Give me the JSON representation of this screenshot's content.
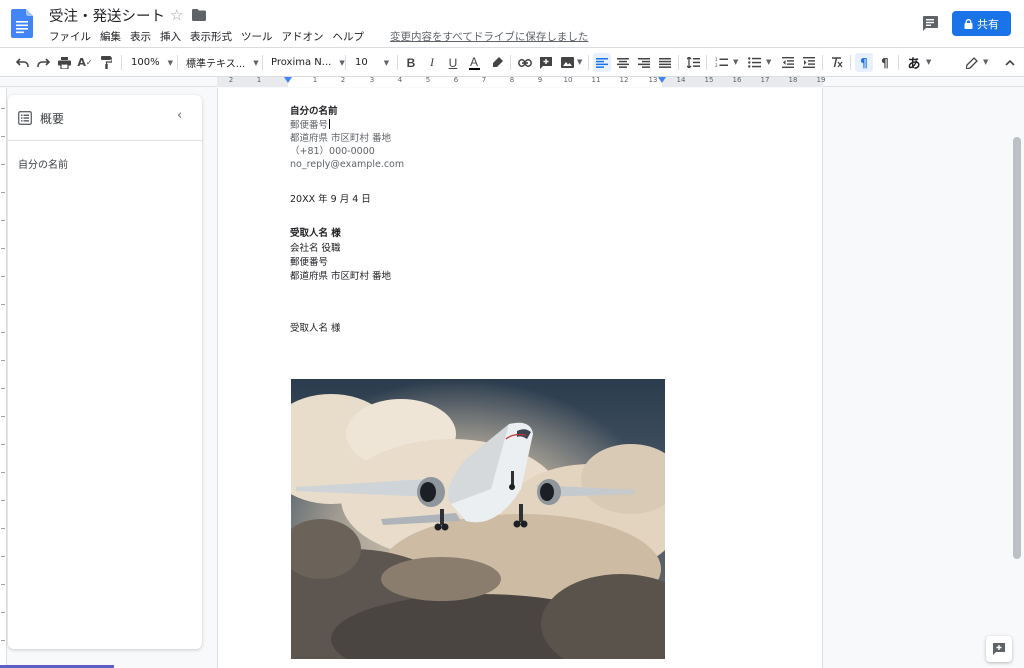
{
  "header": {
    "title": "受注・発送シート",
    "menu": [
      "ファイル",
      "編集",
      "表示",
      "挿入",
      "表示形式",
      "ツール",
      "アドオン",
      "ヘルプ"
    ],
    "save_status": "変更内容をすべてドライブに保存しました",
    "share_label": "共有"
  },
  "toolbar": {
    "zoom": "100%",
    "style": "標準テキス...",
    "font": "Proxima N...",
    "size": "10",
    "input_tool": "あ"
  },
  "ruler": {
    "numbers": [
      "2",
      "1",
      "1",
      "2",
      "3",
      "4",
      "5",
      "6",
      "7",
      "8",
      "9",
      "10",
      "11",
      "12",
      "13",
      "14",
      "15",
      "16",
      "17",
      "18",
      "19"
    ]
  },
  "outline": {
    "title": "概要",
    "items": [
      "自分の名前"
    ]
  },
  "document": {
    "sender_name": "自分の名前",
    "postal": "郵便番号",
    "address": "都道府県 市区町村 番地",
    "phone": "（+81）000-0000",
    "email": "no_reply@example.com",
    "date": "20XX 年 9 月 4 日",
    "recipient_name": "受取人名 様",
    "company": "会社名 役職",
    "recipient_postal": "郵便番号",
    "recipient_address": "都道府県 市区町村 番地",
    "salutation": "受取人名 様"
  },
  "colors": {
    "accent": "#1a73e8",
    "docs_blue": "#4285f4"
  }
}
